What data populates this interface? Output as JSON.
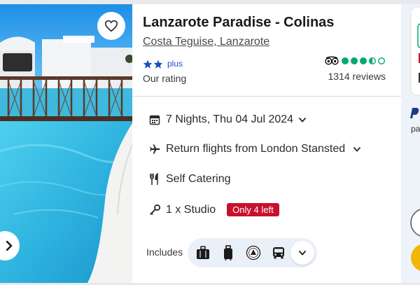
{
  "hotel": {
    "name": "Lanzarote Paradise - Colinas",
    "location": "Costa Teguise, Lanzarote",
    "rating_label": "Our rating",
    "rating_plus": "plus",
    "rating_stars": 2,
    "tripadvisor_score": 3.5,
    "reviews": "1314 reviews"
  },
  "details": {
    "dates": "7 Nights, Thu 04 Jul 2024",
    "flights": "Return flights from London Stansted",
    "board": "Self Catering",
    "room": "1 x Studio",
    "availability_badge": "Only 4 left"
  },
  "includes": {
    "label": "Includes",
    "items": [
      "luggage-icon",
      "hand-luggage-icon",
      "atol-protected-icon",
      "transfer-bus-icon"
    ]
  },
  "colors": {
    "accent": "#1a4fc4",
    "tripadvisor_green": "#00aa6c",
    "badge_red": "#c8102e",
    "pool_blue": "#3fb9de"
  }
}
